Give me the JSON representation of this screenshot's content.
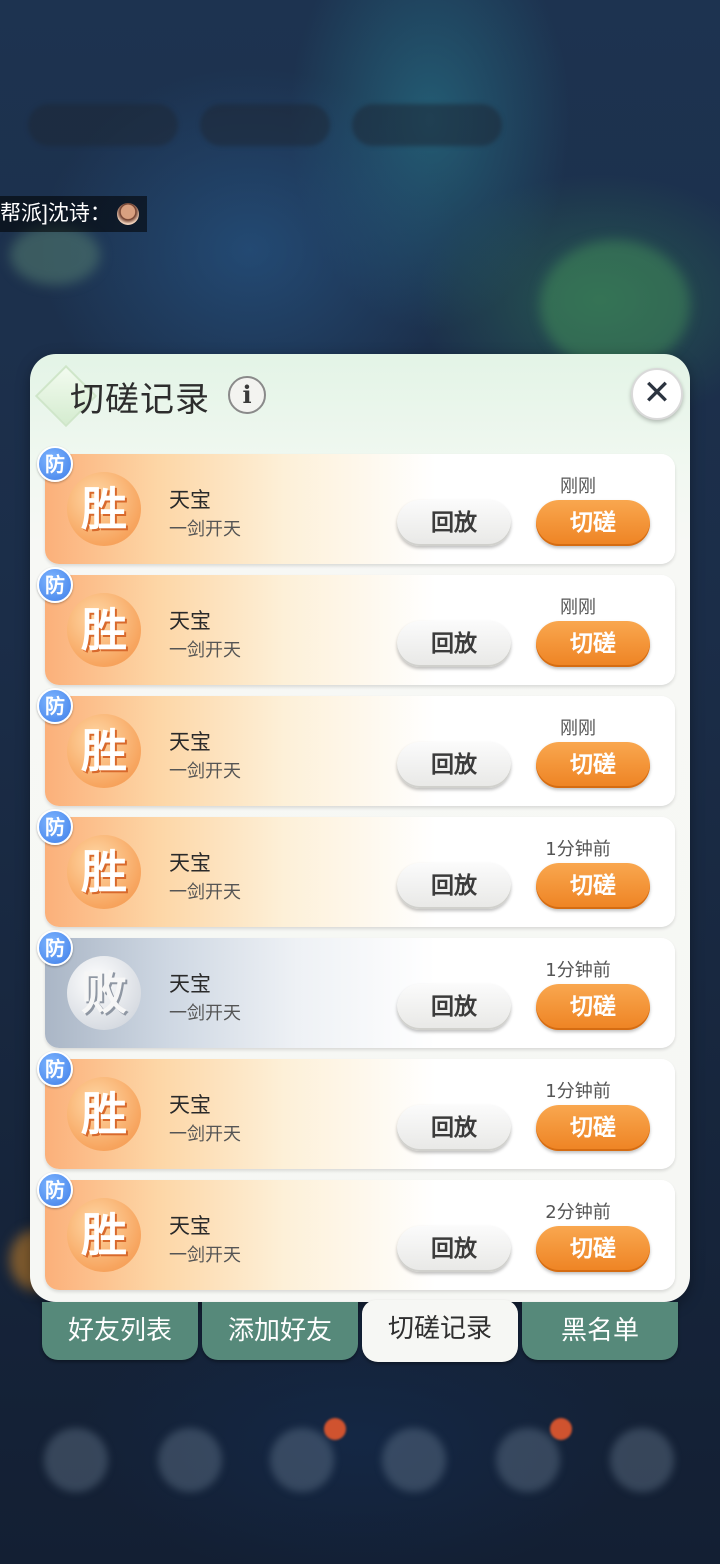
{
  "background": {
    "chat_line": "帮派]沈诗："
  },
  "dialog": {
    "title": "切磋记录",
    "info_icon": "info-icon",
    "close_icon": "close-icon",
    "info_glyph": "i",
    "close_glyph": "✕"
  },
  "records": [
    {
      "side": "防",
      "result": "胜",
      "name": "天宝",
      "subtitle": "一剑开天",
      "time": "刚刚",
      "replay": "回放",
      "spar": "切磋"
    },
    {
      "side": "防",
      "result": "胜",
      "name": "天宝",
      "subtitle": "一剑开天",
      "time": "刚刚",
      "replay": "回放",
      "spar": "切磋"
    },
    {
      "side": "防",
      "result": "胜",
      "name": "天宝",
      "subtitle": "一剑开天",
      "time": "刚刚",
      "replay": "回放",
      "spar": "切磋"
    },
    {
      "side": "防",
      "result": "胜",
      "name": "天宝",
      "subtitle": "一剑开天",
      "time": "1分钟前",
      "replay": "回放",
      "spar": "切磋"
    },
    {
      "side": "防",
      "result": "败",
      "name": "天宝",
      "subtitle": "一剑开天",
      "time": "1分钟前",
      "replay": "回放",
      "spar": "切磋"
    },
    {
      "side": "防",
      "result": "胜",
      "name": "天宝",
      "subtitle": "一剑开天",
      "time": "1分钟前",
      "replay": "回放",
      "spar": "切磋"
    },
    {
      "side": "防",
      "result": "胜",
      "name": "天宝",
      "subtitle": "一剑开天",
      "time": "2分钟前",
      "replay": "回放",
      "spar": "切磋"
    }
  ],
  "tabs": [
    {
      "label": "好友列表",
      "active": false
    },
    {
      "label": "添加好友",
      "active": false
    },
    {
      "label": "切磋记录",
      "active": true
    },
    {
      "label": "黑名单",
      "active": false
    }
  ],
  "colors": {
    "spar_orange": "#ee8323",
    "tab_green": "#56897a",
    "defense_blue": "#3f7ee8"
  }
}
